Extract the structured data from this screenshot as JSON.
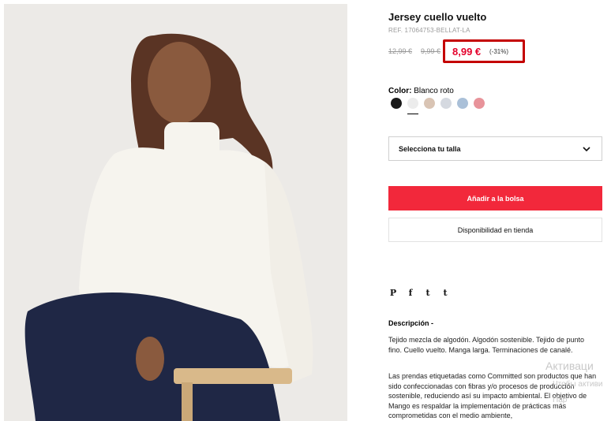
{
  "product": {
    "title": "Jersey cuello vuelto",
    "ref": "REF. 17064753-BELLAT-LA",
    "price_original": "12,99 €",
    "price_previous": "9,99 €",
    "price_current": "8,99 €",
    "discount": "(-31%)"
  },
  "color": {
    "label": "Color:",
    "selected_name": "Blanco roto",
    "swatches": [
      {
        "name": "black",
        "hex": "#1a1a1a"
      },
      {
        "name": "off-white",
        "hex": "#ececec",
        "selected": true
      },
      {
        "name": "beige",
        "hex": "#d9c4b4"
      },
      {
        "name": "light-grey",
        "hex": "#d5d9e0"
      },
      {
        "name": "light-blue",
        "hex": "#aac0d8"
      },
      {
        "name": "pink",
        "hex": "#e8939a"
      }
    ]
  },
  "size_select": {
    "label": "Selecciona tu talla"
  },
  "buttons": {
    "add_to_bag": "Añadir a la bolsa",
    "store_availability": "Disponibilidad en tienda"
  },
  "social": {
    "pinterest": "P",
    "facebook": "f",
    "twitter": "t",
    "tumblr": "t"
  },
  "description": {
    "title": "Descripción -",
    "paragraph1": "Tejido mezcla de algodón. Algodón sostenible. Tejido de punto fino. Cuello vuelto. Manga larga. Terminaciones de canalé.",
    "paragraph2": "Las prendas etiquetadas como Committed son productos que han sido confeccionadas con fibras y/o procesos de producción sostenible, reduciendo así su impacto ambiental. El objetivo de Mango es respaldar la implementación de prácticas más comprometidas con el medio ambiente,"
  },
  "os_watermark": {
    "title": "Активаци",
    "line1": "Чтобы активи",
    "line2": "Пар"
  },
  "colors": {
    "accent_red": "#f2283b",
    "price_red": "#e4002b",
    "highlight_box": "#c40000"
  }
}
